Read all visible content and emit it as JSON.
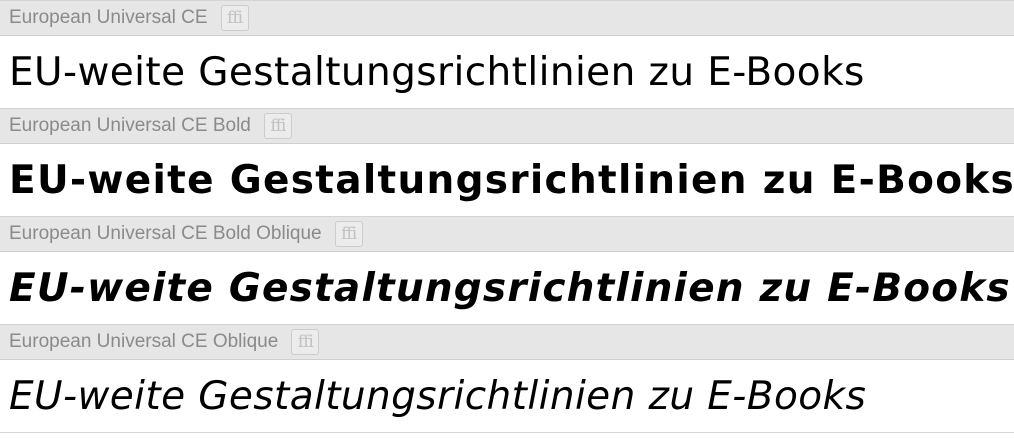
{
  "font_list": {
    "entries": [
      {
        "font_name": "European Universal CE",
        "ligature_badge": "ffi",
        "sample_text": "EU-weite Gestaltungsrichtlinien zu E-Books"
      },
      {
        "font_name": "European Universal CE Bold",
        "ligature_badge": "ffi",
        "sample_text": "EU-weite Gestaltungsrichtlinien zu E-Books"
      },
      {
        "font_name": "European Universal CE Bold Oblique",
        "ligature_badge": "ffi",
        "sample_text": "EU-weite Gestaltungsrichtlinien zu E-Books"
      },
      {
        "font_name": "European Universal CE Oblique",
        "ligature_badge": "ffi",
        "sample_text": "EU-weite Gestaltungsrichtlinien zu E-Books"
      }
    ]
  },
  "colors": {
    "header_background": "#e6e6e6",
    "header_text": "#8a8a8a",
    "sample_text": "#000000",
    "selection_accent": "#8fb6e8"
  }
}
